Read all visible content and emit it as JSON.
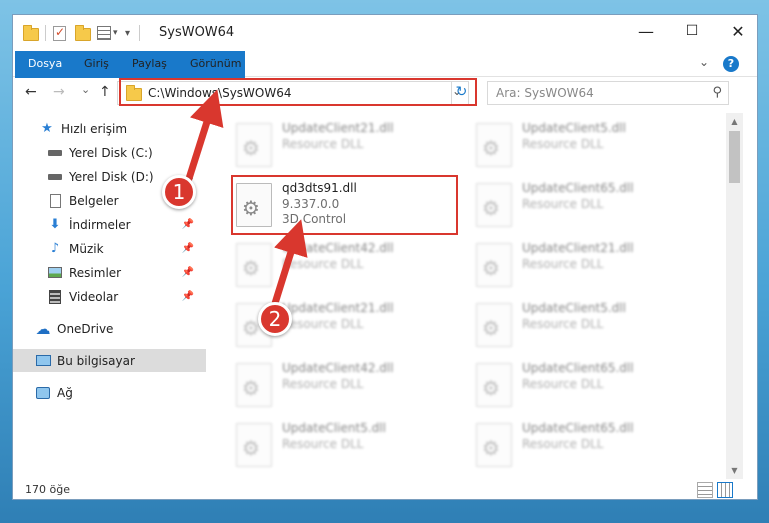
{
  "window": {
    "title": "SysWOW64",
    "controls": {
      "minimize": "—",
      "maximize": "☐",
      "close": "✕"
    }
  },
  "ribbon": {
    "tabs": [
      "Dosya",
      "Giriş",
      "Paylaş",
      "Görünüm"
    ],
    "expand_icon": "chevron-down-icon",
    "help_label": "?"
  },
  "nav": {
    "back": "←",
    "forward": "→",
    "recent": "⌄",
    "up": "↑",
    "address": "C:\\Windows\\SysWOW64",
    "search_placeholder": "Ara: SysWOW64"
  },
  "sidebar": {
    "items": [
      {
        "label": "Hızlı erişim",
        "icon": "star-icon",
        "pinned": false
      },
      {
        "label": "Yerel Disk (C:)",
        "icon": "drive-icon",
        "pinned": false
      },
      {
        "label": "Yerel Disk (D:)",
        "icon": "drive-icon",
        "pinned": false
      },
      {
        "label": "Belgeler",
        "icon": "documents-icon",
        "pinned": true
      },
      {
        "label": "İndirmeler",
        "icon": "download-icon",
        "pinned": true
      },
      {
        "label": "Müzik",
        "icon": "music-icon",
        "pinned": true
      },
      {
        "label": "Resimler",
        "icon": "pictures-icon",
        "pinned": true
      },
      {
        "label": "Videolar",
        "icon": "video-icon",
        "pinned": true
      },
      {
        "label": "OneDrive",
        "icon": "cloud-icon",
        "pinned": false
      },
      {
        "label": "Bu bilgisayar",
        "icon": "computer-icon",
        "pinned": false,
        "selected": true
      },
      {
        "label": "Ağ",
        "icon": "network-icon",
        "pinned": false
      }
    ]
  },
  "files": {
    "highlighted": {
      "name": "qd3dts91.dll",
      "version": "9.337.0.0",
      "description": "3D Control"
    },
    "blurred": [
      {
        "name": "UpdateClient21.dll",
        "description": "Resource DLL"
      },
      {
        "name": "UpdateClient5.dll",
        "description": "Resource DLL"
      },
      {
        "name": "UpdateClient65.dll",
        "description": "Resource DLL"
      },
      {
        "name": "UpdateClient42.dll",
        "description": "Resource DLL"
      },
      {
        "name": "UpdateClient21.dll",
        "description": "Resource DLL"
      },
      {
        "name": "UpdateClient21.dll",
        "description": "Resource DLL"
      },
      {
        "name": "UpdateClient5.dll",
        "description": "Resource DLL"
      },
      {
        "name": "UpdateClient42.dll",
        "description": "Resource DLL"
      },
      {
        "name": "UpdateClient65.dll",
        "description": "Resource DLL"
      },
      {
        "name": "UpdateClient5.dll",
        "description": "Resource DLL"
      },
      {
        "name": "UpdateClient65.dll",
        "description": "Resource DLL"
      }
    ]
  },
  "status": {
    "item_count": "170 öğe"
  },
  "annotations": {
    "step1": "1",
    "step2": "2",
    "color": "#d9372e"
  }
}
